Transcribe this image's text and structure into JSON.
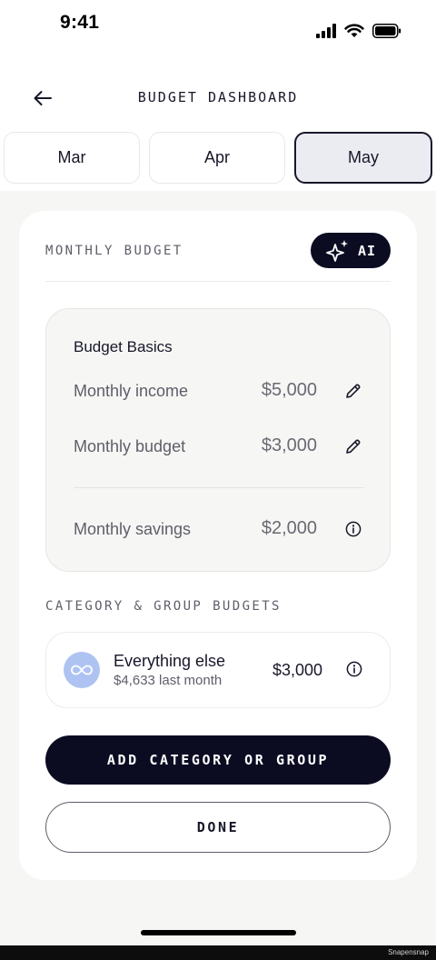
{
  "status_bar": {
    "time": "9:41",
    "icons": [
      "cellular-signal-icon",
      "wifi-icon",
      "battery-icon"
    ]
  },
  "header": {
    "back_icon": "arrow-left-icon",
    "title": "BUDGET DASHBOARD"
  },
  "months": [
    {
      "label": "Mar",
      "active": false
    },
    {
      "label": "Apr",
      "active": false
    },
    {
      "label": "May",
      "active": true
    }
  ],
  "monthly_budget": {
    "section_label": "MONTHLY BUDGET",
    "ai_button": {
      "icon": "sparkle-icon",
      "label": "AI"
    },
    "basics": {
      "title": "Budget Basics",
      "rows": [
        {
          "label": "Monthly income",
          "value": "$5,000",
          "action_icon": "pencil-icon"
        },
        {
          "label": "Monthly budget",
          "value": "$3,000",
          "action_icon": "pencil-icon"
        },
        {
          "label": "Monthly savings",
          "value": "$2,000",
          "action_icon": "info-icon"
        }
      ]
    }
  },
  "category_budgets": {
    "section_label": "CATEGORY & GROUP BUDGETS",
    "items": [
      {
        "icon": "infinity-icon",
        "name": "Everything else",
        "subtitle": "$4,633 last month",
        "value": "$3,000",
        "action_icon": "info-icon"
      }
    ]
  },
  "actions": {
    "add_label": "ADD CATEGORY OR GROUP",
    "done_label": "DONE"
  },
  "watermark": "Snapensnap",
  "colors": {
    "navy": "#0b0b22",
    "page_bg": "#f6f6f4",
    "active_tab_bg": "#ebebf2",
    "avatar_blue": "#aec3f2",
    "muted_text": "#5e5e6a"
  }
}
